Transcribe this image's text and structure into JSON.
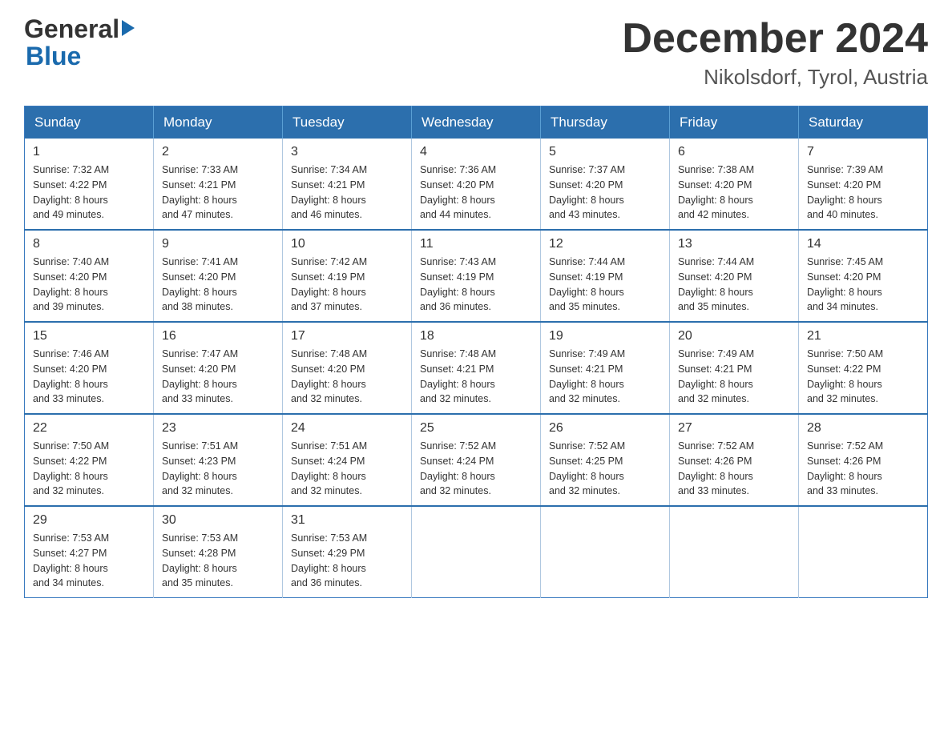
{
  "logo": {
    "general": "General",
    "blue": "Blue"
  },
  "title": "December 2024",
  "subtitle": "Nikolsdorf, Tyrol, Austria",
  "days_of_week": [
    "Sunday",
    "Monday",
    "Tuesday",
    "Wednesday",
    "Thursday",
    "Friday",
    "Saturday"
  ],
  "weeks": [
    [
      {
        "day": "1",
        "sunrise": "7:32 AM",
        "sunset": "4:22 PM",
        "daylight": "8 hours and 49 minutes."
      },
      {
        "day": "2",
        "sunrise": "7:33 AM",
        "sunset": "4:21 PM",
        "daylight": "8 hours and 47 minutes."
      },
      {
        "day": "3",
        "sunrise": "7:34 AM",
        "sunset": "4:21 PM",
        "daylight": "8 hours and 46 minutes."
      },
      {
        "day": "4",
        "sunrise": "7:36 AM",
        "sunset": "4:20 PM",
        "daylight": "8 hours and 44 minutes."
      },
      {
        "day": "5",
        "sunrise": "7:37 AM",
        "sunset": "4:20 PM",
        "daylight": "8 hours and 43 minutes."
      },
      {
        "day": "6",
        "sunrise": "7:38 AM",
        "sunset": "4:20 PM",
        "daylight": "8 hours and 42 minutes."
      },
      {
        "day": "7",
        "sunrise": "7:39 AM",
        "sunset": "4:20 PM",
        "daylight": "8 hours and 40 minutes."
      }
    ],
    [
      {
        "day": "8",
        "sunrise": "7:40 AM",
        "sunset": "4:20 PM",
        "daylight": "8 hours and 39 minutes."
      },
      {
        "day": "9",
        "sunrise": "7:41 AM",
        "sunset": "4:20 PM",
        "daylight": "8 hours and 38 minutes."
      },
      {
        "day": "10",
        "sunrise": "7:42 AM",
        "sunset": "4:19 PM",
        "daylight": "8 hours and 37 minutes."
      },
      {
        "day": "11",
        "sunrise": "7:43 AM",
        "sunset": "4:19 PM",
        "daylight": "8 hours and 36 minutes."
      },
      {
        "day": "12",
        "sunrise": "7:44 AM",
        "sunset": "4:19 PM",
        "daylight": "8 hours and 35 minutes."
      },
      {
        "day": "13",
        "sunrise": "7:44 AM",
        "sunset": "4:20 PM",
        "daylight": "8 hours and 35 minutes."
      },
      {
        "day": "14",
        "sunrise": "7:45 AM",
        "sunset": "4:20 PM",
        "daylight": "8 hours and 34 minutes."
      }
    ],
    [
      {
        "day": "15",
        "sunrise": "7:46 AM",
        "sunset": "4:20 PM",
        "daylight": "8 hours and 33 minutes."
      },
      {
        "day": "16",
        "sunrise": "7:47 AM",
        "sunset": "4:20 PM",
        "daylight": "8 hours and 33 minutes."
      },
      {
        "day": "17",
        "sunrise": "7:48 AM",
        "sunset": "4:20 PM",
        "daylight": "8 hours and 32 minutes."
      },
      {
        "day": "18",
        "sunrise": "7:48 AM",
        "sunset": "4:21 PM",
        "daylight": "8 hours and 32 minutes."
      },
      {
        "day": "19",
        "sunrise": "7:49 AM",
        "sunset": "4:21 PM",
        "daylight": "8 hours and 32 minutes."
      },
      {
        "day": "20",
        "sunrise": "7:49 AM",
        "sunset": "4:21 PM",
        "daylight": "8 hours and 32 minutes."
      },
      {
        "day": "21",
        "sunrise": "7:50 AM",
        "sunset": "4:22 PM",
        "daylight": "8 hours and 32 minutes."
      }
    ],
    [
      {
        "day": "22",
        "sunrise": "7:50 AM",
        "sunset": "4:22 PM",
        "daylight": "8 hours and 32 minutes."
      },
      {
        "day": "23",
        "sunrise": "7:51 AM",
        "sunset": "4:23 PM",
        "daylight": "8 hours and 32 minutes."
      },
      {
        "day": "24",
        "sunrise": "7:51 AM",
        "sunset": "4:24 PM",
        "daylight": "8 hours and 32 minutes."
      },
      {
        "day": "25",
        "sunrise": "7:52 AM",
        "sunset": "4:24 PM",
        "daylight": "8 hours and 32 minutes."
      },
      {
        "day": "26",
        "sunrise": "7:52 AM",
        "sunset": "4:25 PM",
        "daylight": "8 hours and 32 minutes."
      },
      {
        "day": "27",
        "sunrise": "7:52 AM",
        "sunset": "4:26 PM",
        "daylight": "8 hours and 33 minutes."
      },
      {
        "day": "28",
        "sunrise": "7:52 AM",
        "sunset": "4:26 PM",
        "daylight": "8 hours and 33 minutes."
      }
    ],
    [
      {
        "day": "29",
        "sunrise": "7:53 AM",
        "sunset": "4:27 PM",
        "daylight": "8 hours and 34 minutes."
      },
      {
        "day": "30",
        "sunrise": "7:53 AM",
        "sunset": "4:28 PM",
        "daylight": "8 hours and 35 minutes."
      },
      {
        "day": "31",
        "sunrise": "7:53 AM",
        "sunset": "4:29 PM",
        "daylight": "8 hours and 36 minutes."
      },
      null,
      null,
      null,
      null
    ]
  ],
  "labels": {
    "sunrise": "Sunrise:",
    "sunset": "Sunset:",
    "daylight": "Daylight:"
  }
}
